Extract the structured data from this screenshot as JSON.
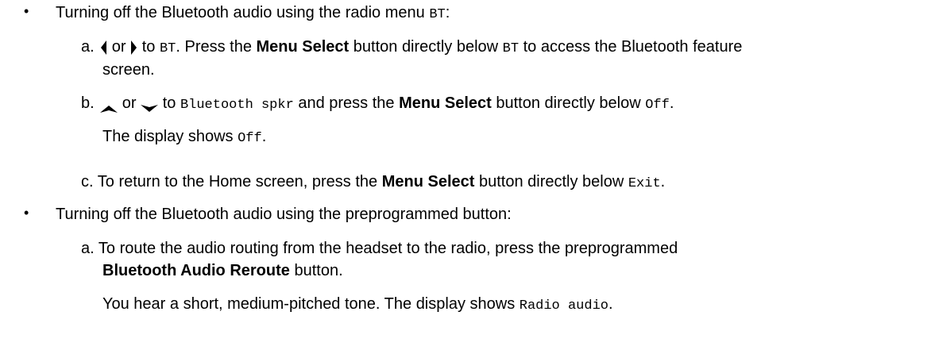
{
  "section1": {
    "bullet": "•",
    "intro": "Turning off the Bluetooth audio using the radio menu ",
    "intro_code": "BT",
    "intro_end": ":",
    "step_a": {
      "letter": "a.",
      "or": " or ",
      "to": " to ",
      "code_bt": "BT",
      "mid": ". Press the ",
      "bold": "Menu Select",
      "after_bold": " button directly below ",
      "code_bt2": "BT",
      "end": " to access the Bluetooth feature",
      "cont": "screen.",
      "left_icon": "left-arrow-icon",
      "right_icon": "right-arrow-icon"
    },
    "step_b": {
      "letter": "b.",
      "or": " or ",
      "to": " to ",
      "code_spkr": "Bluetooth spkr",
      "mid": " and press the ",
      "bold": "Menu Select",
      "after_bold": " button directly below ",
      "code_off": "Off",
      "end": ".",
      "note": "The display shows ",
      "note_code": "Off",
      "note_end": ".",
      "up_icon": "up-arrow-icon",
      "down_icon": "down-arrow-icon"
    },
    "step_c": {
      "letter": "c.",
      "text": "To return to the Home screen, press the ",
      "bold": "Menu Select",
      "after_bold": " button directly below ",
      "code_exit": "Exit",
      "end": "."
    }
  },
  "section2": {
    "bullet": "•",
    "intro": "Turning off the Bluetooth audio using the preprogrammed button:",
    "step_a": {
      "letter": "a.",
      "text": "To route the audio routing from the headset to the radio, press the preprogrammed",
      "bold": "Bluetooth Audio Reroute",
      "end": " button.",
      "note": "You hear a short, medium-pitched tone. The display shows ",
      "note_code": "Radio audio",
      "note_end": "."
    }
  }
}
